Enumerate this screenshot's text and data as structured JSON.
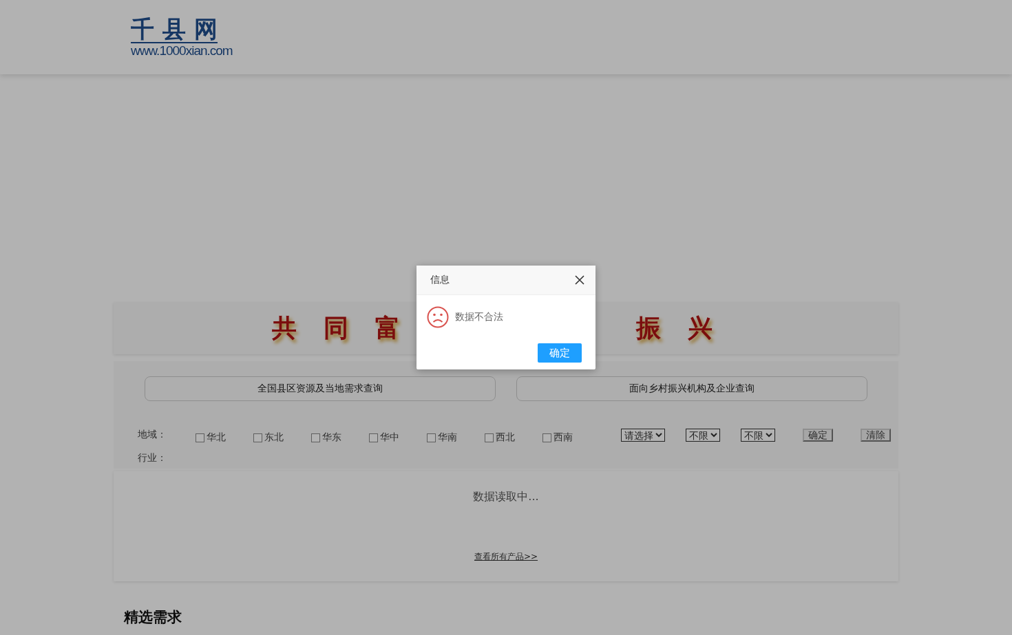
{
  "logo": {
    "title": "千 县 网",
    "url": "www.1000xian.com"
  },
  "banner": {
    "left": [
      "共",
      "同",
      "富"
    ],
    "right": [
      "振",
      "兴"
    ]
  },
  "tabs": [
    {
      "label": "全国县区资源及当地需求查询",
      "selected": false
    },
    {
      "label": "面向乡村振兴机构及企业查询",
      "selected": false
    }
  ],
  "filter": {
    "region_label": "地域：",
    "regions": [
      {
        "label": "华北",
        "checked": false
      },
      {
        "label": "东北",
        "checked": false
      },
      {
        "label": "华东",
        "checked": false
      },
      {
        "label": "华中",
        "checked": false
      },
      {
        "label": "华南",
        "checked": false
      },
      {
        "label": "西北",
        "checked": false
      },
      {
        "label": "西南",
        "checked": false
      }
    ],
    "selects": [
      "请选择",
      "不限",
      "不限"
    ],
    "buttons": [
      "确定",
      "清除"
    ],
    "industry_label": "行业："
  },
  "results": {
    "status": "数据读取中...",
    "link": "查看所有产品>>"
  },
  "section_title": "精选需求",
  "dialog": {
    "title": "信息",
    "message": "数据不合法",
    "button": "确定"
  }
}
